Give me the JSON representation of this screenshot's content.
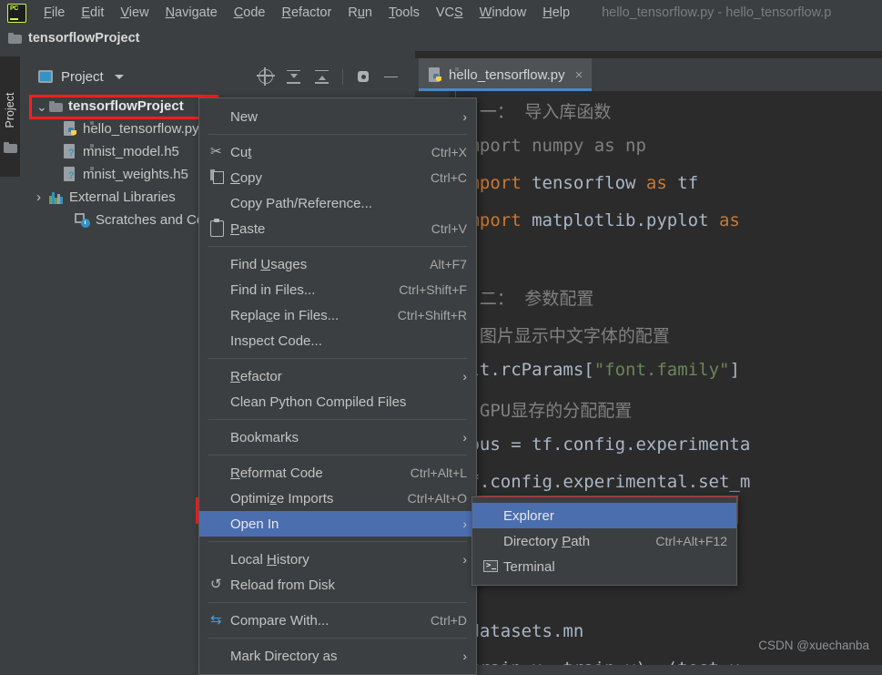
{
  "window": {
    "title": "hello_tensorflow.py - hello_tensorflow.p",
    "logo_text": "PC"
  },
  "menubar": {
    "items": [
      {
        "label": "File",
        "mnemonic": "F"
      },
      {
        "label": "Edit",
        "mnemonic": "E"
      },
      {
        "label": "View",
        "mnemonic": "V"
      },
      {
        "label": "Navigate",
        "mnemonic": "N"
      },
      {
        "label": "Code",
        "mnemonic": "C"
      },
      {
        "label": "Refactor",
        "mnemonic": "R"
      },
      {
        "label": "Run",
        "mnemonic": "u"
      },
      {
        "label": "Tools",
        "mnemonic": "T"
      },
      {
        "label": "VCS",
        "mnemonic": "S"
      },
      {
        "label": "Window",
        "mnemonic": "W"
      },
      {
        "label": "Help",
        "mnemonic": "H"
      }
    ]
  },
  "navbar": {
    "crumb": "tensorflowProject"
  },
  "toolstrip": {
    "vertical_tab": "Project"
  },
  "project_panel": {
    "title": "Project",
    "toolbar": [
      {
        "name": "locate-icon",
        "tip": "Select Opened File"
      },
      {
        "name": "expand-all-icon",
        "tip": "Expand All"
      },
      {
        "name": "collapse-all-icon",
        "tip": "Collapse All"
      },
      {
        "name": "settings-gear-icon",
        "tip": "Settings"
      },
      {
        "name": "hide-icon",
        "tip": "Hide"
      }
    ],
    "tree": [
      {
        "label": "tensorflowProject",
        "icon": "folder-icon",
        "arrow": "expanded",
        "level": 0,
        "highlighted": true
      },
      {
        "label": "hello_tensorflow.py",
        "icon": "python-file-icon",
        "arrow": "none",
        "level": 1
      },
      {
        "label": "mnist_model.h5",
        "icon": "unknown-file-icon",
        "arrow": "none",
        "level": 1
      },
      {
        "label": "mnist_weights.h5",
        "icon": "unknown-file-icon",
        "arrow": "none",
        "level": 1
      },
      {
        "label": "External Libraries",
        "icon": "libraries-icon",
        "arrow": "collapsed",
        "level": 0
      },
      {
        "label": "Scratches and Consoles",
        "icon": "scratches-icon",
        "arrow": "none",
        "level": 0
      }
    ]
  },
  "editor": {
    "tab": {
      "label": "hello_tensorflow.py",
      "close": "×",
      "icon": "python-file-icon"
    },
    "lines": [
      {
        "segments": [
          {
            "t": "# 一： 导入库函数",
            "c": "cm"
          }
        ],
        "fold": "none"
      },
      {
        "segments": [
          {
            "t": "import ",
            "c": "cm"
          },
          {
            "t": "numpy ",
            "c": "cm"
          },
          {
            "t": "as ",
            "c": "cm"
          },
          {
            "t": "np",
            "c": "cm"
          }
        ],
        "fold": "start"
      },
      {
        "segments": [
          {
            "t": "import ",
            "c": "kw"
          },
          {
            "t": "tensorflow ",
            "c": "pl"
          },
          {
            "t": "as ",
            "c": "kw"
          },
          {
            "t": "tf",
            "c": "pl"
          }
        ],
        "fold": "none"
      },
      {
        "segments": [
          {
            "t": "import ",
            "c": "kw"
          },
          {
            "t": "matplotlib.pyplot ",
            "c": "pl"
          },
          {
            "t": "as",
            "c": "kw"
          }
        ],
        "fold": "end"
      },
      {
        "segments": [
          {
            "t": "",
            "c": "pl"
          }
        ],
        "fold": "none"
      },
      {
        "segments": [
          {
            "t": "# 二： 参数配置",
            "c": "cm"
          }
        ],
        "fold": "start"
      },
      {
        "segments": [
          {
            "t": "# 图片显示中文字体的配置",
            "c": "cm"
          }
        ],
        "fold": "end"
      },
      {
        "segments": [
          {
            "t": "plt.rcParams",
            "c": "pl"
          },
          {
            "t": "[",
            "c": "pl"
          },
          {
            "t": "\"font.family\"",
            "c": "st"
          },
          {
            "t": "]",
            "c": "pl"
          }
        ],
        "fold": "none"
      },
      {
        "segments": [
          {
            "t": "# GPU显存的分配配置",
            "c": "cm"
          }
        ],
        "fold": "none"
      },
      {
        "segments": [
          {
            "t": "gpus = tf.config.experimenta",
            "c": "pl"
          }
        ],
        "fold": "none"
      },
      {
        "segments": [
          {
            "t": "tf.config.experimental.set_m",
            "c": "pl"
          }
        ],
        "fold": "none"
      },
      {
        "segments": [
          {
            "t": "",
            "c": "pl"
          }
        ],
        "fold": "none"
      },
      {
        "segments": [
          {
            "t": "",
            "c": "pl"
          }
        ],
        "fold": "none"
      },
      {
        "segments": [
          {
            "t": "",
            "c": "pl"
          }
        ],
        "fold": "none"
      },
      {
        "segments": [
          {
            "t": ".datasets.mn",
            "c": "pl"
          }
        ],
        "fold": "none"
      },
      {
        "segments": [
          {
            "t": "(train_x, train_y), (test_x,",
            "c": "pl"
          }
        ],
        "fold": "none"
      }
    ],
    "watermark": "CSDN @xuechanba"
  },
  "context_menu": {
    "items": [
      {
        "type": "item",
        "label": "New",
        "key": "",
        "arrow": true,
        "icon": "none"
      },
      {
        "type": "sep"
      },
      {
        "type": "item",
        "label": "Cut",
        "mnemonic": "t",
        "key": "Ctrl+X",
        "icon": "cut-icon"
      },
      {
        "type": "item",
        "label": "Copy",
        "mnemonic": "C",
        "key": "Ctrl+C",
        "icon": "copy-icon"
      },
      {
        "type": "item",
        "label": "Copy Path/Reference...",
        "key": "",
        "icon": "none"
      },
      {
        "type": "item",
        "label": "Paste",
        "mnemonic": "P",
        "key": "Ctrl+V",
        "icon": "paste-icon"
      },
      {
        "type": "sep"
      },
      {
        "type": "item",
        "label": "Find Usages",
        "mnemonic": "U",
        "key": "Alt+F7",
        "icon": "none"
      },
      {
        "type": "item",
        "label": "Find in Files...",
        "key": "Ctrl+Shift+F",
        "icon": "none"
      },
      {
        "type": "item",
        "label": "Replace in Files...",
        "mnemonic": "c",
        "key": "Ctrl+Shift+R",
        "icon": "none"
      },
      {
        "type": "item",
        "label": "Inspect Code...",
        "key": "",
        "icon": "none"
      },
      {
        "type": "sep"
      },
      {
        "type": "item",
        "label": "Refactor",
        "mnemonic": "R",
        "key": "",
        "arrow": true,
        "icon": "none"
      },
      {
        "type": "item",
        "label": "Clean Python Compiled Files",
        "key": "",
        "icon": "none"
      },
      {
        "type": "sep"
      },
      {
        "type": "item",
        "label": "Bookmarks",
        "key": "",
        "arrow": true,
        "icon": "none"
      },
      {
        "type": "sep"
      },
      {
        "type": "item",
        "label": "Reformat Code",
        "mnemonic": "R",
        "key": "Ctrl+Alt+L",
        "icon": "none"
      },
      {
        "type": "item",
        "label": "Optimize Imports",
        "mnemonic": "z",
        "key": "Ctrl+Alt+O",
        "icon": "none"
      },
      {
        "type": "item",
        "label": "Open In",
        "key": "",
        "arrow": true,
        "icon": "none",
        "selected": true,
        "annotated": true
      },
      {
        "type": "sep"
      },
      {
        "type": "item",
        "label": "Local History",
        "mnemonic": "H",
        "key": "",
        "arrow": true,
        "icon": "none"
      },
      {
        "type": "item",
        "label": "Reload from Disk",
        "key": "",
        "icon": "reload-icon"
      },
      {
        "type": "sep"
      },
      {
        "type": "item",
        "label": "Compare With...",
        "key": "Ctrl+D",
        "icon": "compare-icon"
      },
      {
        "type": "sep"
      },
      {
        "type": "item",
        "label": "Mark Directory as",
        "key": "",
        "arrow": true,
        "icon": "none"
      }
    ]
  },
  "submenu": {
    "items": [
      {
        "label": "Explorer",
        "key": "",
        "icon": "none",
        "selected": true
      },
      {
        "label": "Directory Path",
        "mnemonic": "P",
        "key": "Ctrl+Alt+F12",
        "icon": "none"
      },
      {
        "label": "Terminal",
        "key": "",
        "icon": "terminal-icon"
      }
    ]
  },
  "colors": {
    "panel_bg": "#3c3f41",
    "editor_bg": "#2b2b2b",
    "selection_blue": "#4b6eaf",
    "annotation_red": "#ff1d1d",
    "tab_underline": "#4a88c7",
    "comment_gray": "#808080",
    "keyword_orange": "#cc7832",
    "string_green": "#6a8759",
    "plain_text": "#a9b7c6"
  }
}
